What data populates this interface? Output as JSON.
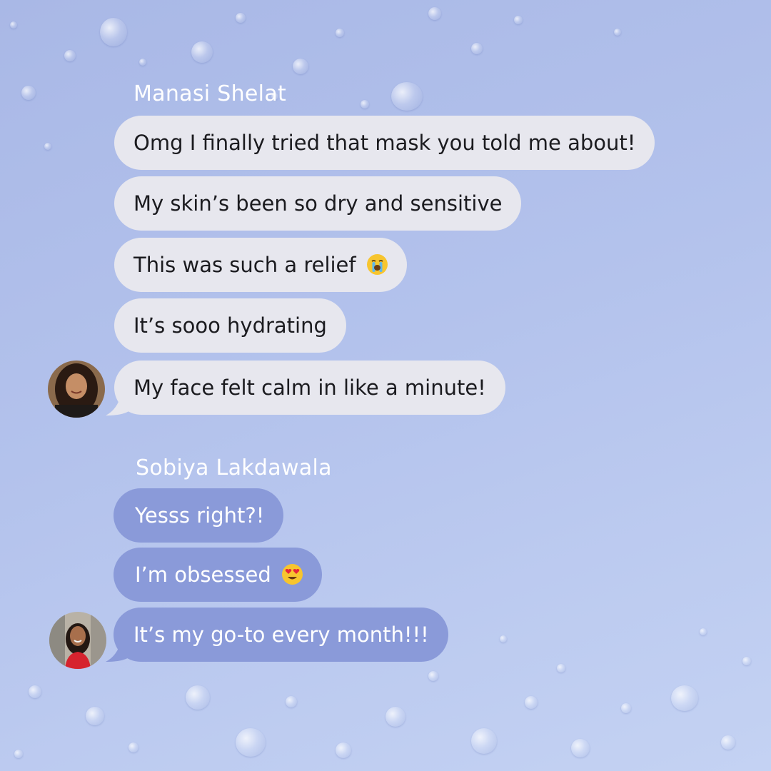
{
  "thread1": {
    "sender_name": "Manasi Shelat",
    "messages": [
      {
        "text": "Omg I finally tried that mask you told me about!"
      },
      {
        "text": "My skin’s been so dry and sensitive"
      },
      {
        "text": "This was such a relief",
        "emoji": "loudly-crying-face-emoji"
      },
      {
        "text": "It’s sooo hydrating"
      },
      {
        "text": "My face felt calm in like a minute!"
      }
    ],
    "bubble_color": "#e7e7ee",
    "text_color": "#1b1b1f"
  },
  "thread2": {
    "sender_name": "Sobiya Lakdawala",
    "messages": [
      {
        "text": "Yesss right?!"
      },
      {
        "text": "I’m obsessed",
        "emoji": "heart-eyes-emoji"
      },
      {
        "text": "It’s my go-to every month!!!"
      }
    ],
    "bubble_color": "#8a9ad9",
    "text_color": "#ffffff"
  },
  "background": {
    "style": "water-droplets",
    "color_top": "#a9b8e6",
    "color_bottom": "#c4d2f3"
  }
}
